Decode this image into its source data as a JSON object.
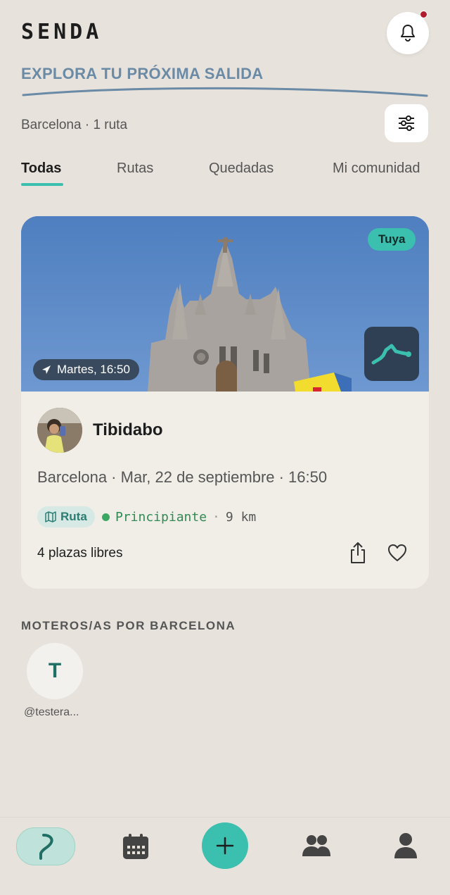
{
  "app": {
    "logo": "SENDA",
    "tagline": "EXPLORA TU PRÓXIMA SALIDA"
  },
  "header": {
    "location": "Barcelona · 1 ruta"
  },
  "tabs": [
    {
      "label": "Todas",
      "active": true
    },
    {
      "label": "Rutas",
      "active": false
    },
    {
      "label": "Quedadas",
      "active": false
    },
    {
      "label": "Mi comunidad",
      "active": false
    }
  ],
  "card": {
    "badge": "Tuya",
    "time_pill": "Martes, 16:50",
    "title": "Tibidabo",
    "meta": "Barcelona · Mar, 22 de septiembre · 16:50",
    "type_tag": "Ruta",
    "level": "Principiante",
    "separator": "·",
    "distance": "9 km",
    "spots": "4 plazas libres"
  },
  "community": {
    "title": "MOTEROS/AS POR BARCELONA",
    "users": [
      {
        "initial": "T",
        "handle": "@testera..."
      }
    ]
  },
  "colors": {
    "accent": "#3bbfae",
    "background": "#e7e2dc",
    "card": "#f1eee8",
    "tagline": "#6a8aa6"
  },
  "icons": [
    "bell-icon",
    "filter-icon",
    "navigation-arrow-icon",
    "route-map-icon",
    "map-icon",
    "share-icon",
    "heart-icon",
    "route-home-icon",
    "calendar-icon",
    "plus-icon",
    "community-icon",
    "profile-icon"
  ]
}
